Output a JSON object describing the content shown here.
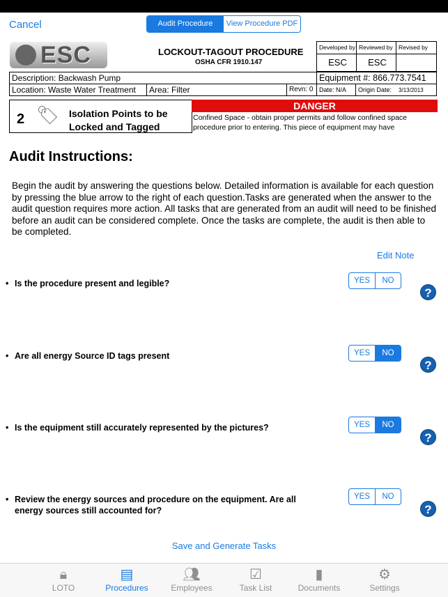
{
  "nav": {
    "cancel": "Cancel",
    "segments": [
      {
        "label": "Audit Procedure",
        "selected": true
      },
      {
        "label": "View Procedure PDF",
        "selected": false
      }
    ]
  },
  "doc": {
    "logo": "ESC",
    "title": "LOCKOUT-TAGOUT PROCEDURE",
    "subtitle": "OSHA CFR 1910.147",
    "developed_by_label": "Developed by",
    "reviewed_by_label": "Reviewed by",
    "revised_by_label": "Revised by",
    "developed_by": "ESC",
    "reviewed_by": "ESC",
    "revised_by": "",
    "description": "Description: Backwash Pump",
    "equipment": "Equipment #: 866.773.7541",
    "location": "Location:  Waste Water Treatment",
    "area": "Area: Filter",
    "revn": "Revn: 0",
    "date": "Date: N/A",
    "origin_label": "Origin Date:",
    "origin_date": "3/13/2013",
    "isolation_count": "2",
    "isolation_text": "Isolation Points to be Locked and Tagged",
    "danger": "DANGER",
    "danger_text": "Confined Space - obtain proper permits and follow confined space procedure prior to entering.  This piece of equipment may have"
  },
  "audit": {
    "heading": "Audit Instructions:",
    "instructions": "Begin the audit by answering the questions below. Detailed information is available for each question by pressing the blue arrow to the right of each question.Tasks are generated when the answer to the audit question requires more action. All tasks that are generated from an audit will need to be finished before an audit can be considered complete. Once the tasks are complete, the audit is then able to be completed.",
    "edit_note": "Edit Note",
    "yes": "YES",
    "no": "NO",
    "help": "?",
    "questions": [
      {
        "text": "Is the procedure present and legible?",
        "answer": null
      },
      {
        "text": "Are all energy Source ID tags present",
        "answer": "NO"
      },
      {
        "text": "Is the equipment still accurately represented by the pictures?",
        "answer": "NO"
      },
      {
        "text": "Review the energy sources and procedure on the equipment. Are all energy sources still accounted for?",
        "answer": null
      }
    ],
    "save": "Save and Generate Tasks"
  },
  "tabs": [
    {
      "label": "LOTO",
      "icon": "lock-icon"
    },
    {
      "label": "Procedures",
      "icon": "notepad-icon",
      "active": true
    },
    {
      "label": "Employees",
      "icon": "people-icon"
    },
    {
      "label": "Task List",
      "icon": "checkbox-icon"
    },
    {
      "label": "Documents",
      "icon": "book-icon"
    },
    {
      "label": "Settings",
      "icon": "gear-icon"
    }
  ],
  "colors": {
    "accent": "#1a7ae0",
    "danger": "#e10c0c"
  }
}
